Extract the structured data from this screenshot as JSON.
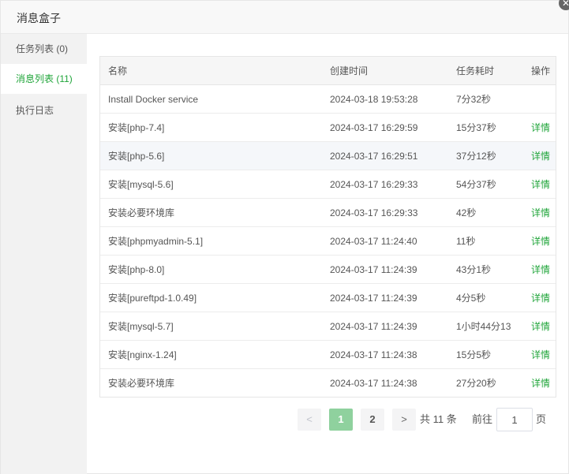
{
  "header": {
    "title": "消息盒子"
  },
  "sidebar": {
    "items": [
      {
        "label": "任务列表 (0)"
      },
      {
        "label": "消息列表 (11)"
      },
      {
        "label": "执行日志"
      }
    ]
  },
  "table": {
    "columns": [
      "名称",
      "创建时间",
      "任务耗时",
      "操作"
    ],
    "rows": [
      {
        "name": "Install Docker service",
        "time": "2024-03-18 19:53:28",
        "duration": "7分32秒",
        "op": ""
      },
      {
        "name": "安装[php-7.4]",
        "time": "2024-03-17 16:29:59",
        "duration": "15分37秒",
        "op": "详情"
      },
      {
        "name": "安装[php-5.6]",
        "time": "2024-03-17 16:29:51",
        "duration": "37分12秒",
        "op": "详情"
      },
      {
        "name": "安装[mysql-5.6]",
        "time": "2024-03-17 16:29:33",
        "duration": "54分37秒",
        "op": "详情"
      },
      {
        "name": "安装必要环境库",
        "time": "2024-03-17 16:29:33",
        "duration": "42秒",
        "op": "详情"
      },
      {
        "name": "安装[phpmyadmin-5.1]",
        "time": "2024-03-17 11:24:40",
        "duration": "11秒",
        "op": "详情"
      },
      {
        "name": "安装[php-8.0]",
        "time": "2024-03-17 11:24:39",
        "duration": "43分1秒",
        "op": "详情"
      },
      {
        "name": "安装[pureftpd-1.0.49]",
        "time": "2024-03-17 11:24:39",
        "duration": "4分5秒",
        "op": "详情"
      },
      {
        "name": "安装[mysql-5.7]",
        "time": "2024-03-17 11:24:39",
        "duration": "1小时44分13",
        "op": "详情"
      },
      {
        "name": "安装[nginx-1.24]",
        "time": "2024-03-17 11:24:38",
        "duration": "15分5秒",
        "op": "详情"
      },
      {
        "name": "安装必要环境库",
        "time": "2024-03-17 11:24:38",
        "duration": "27分20秒",
        "op": "详情"
      }
    ]
  },
  "pagination": {
    "prev": "<",
    "next": ">",
    "pages": [
      "1",
      "2"
    ],
    "total": "共 11 条",
    "goto_label": "前往",
    "goto_value": "1",
    "page_unit": "页"
  },
  "icons": {
    "close": "close-icon",
    "prev": "chevron-left-icon",
    "next": "chevron-right-icon"
  },
  "colors": {
    "accent": "#20a53a",
    "active_page": "#8fd19e"
  }
}
